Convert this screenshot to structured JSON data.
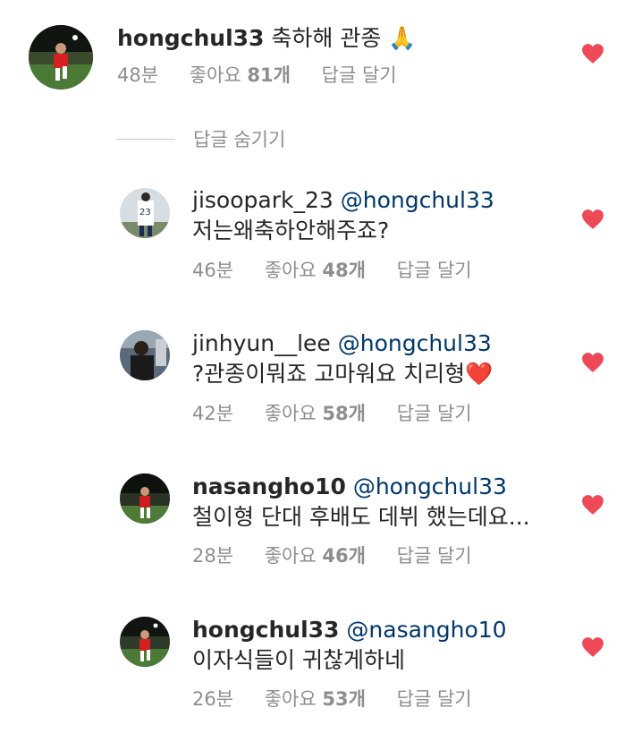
{
  "colors": {
    "heart": "#ed4956",
    "mention": "#00376b",
    "meta": "#8e8e8e",
    "text": "#262626"
  },
  "main_comment": {
    "username": "hongchul33",
    "text": "축하해 관종",
    "emoji": "🙏",
    "time": "48분",
    "likes_label": "좋아요",
    "likes_count": "81개",
    "reply_label": "답글 달기",
    "liked": true,
    "heart_icon": "heart-icon-filled"
  },
  "hide_replies": "답글 숨기기",
  "replies": [
    {
      "username": "jisoopark_23",
      "mention": "@hongchul33",
      "text": "저는왜축하안해주죠?",
      "time": "46분",
      "likes_label": "좋아요",
      "likes_count": "48개",
      "reply_label": "답글 달기",
      "liked": true
    },
    {
      "username": "jinhyun__lee",
      "mention": "@hongchul33",
      "text": "?관종이뭐죠 고마워요 치리형",
      "emoji": "❤️",
      "time": "42분",
      "likes_label": "좋아요",
      "likes_count": "58개",
      "reply_label": "답글 달기",
      "liked": true
    },
    {
      "username": "nasangho10",
      "mention": "@hongchul33",
      "text": "철이형 단대 후배도 데뷔 했는데요...",
      "time": "28분",
      "likes_label": "좋아요",
      "likes_count": "46개",
      "reply_label": "답글 달기",
      "liked": true
    },
    {
      "username": "hongchul33",
      "mention": "@nasangho10",
      "text": "이자식들이 귀찮게하네",
      "time": "26분",
      "likes_label": "좋아요",
      "likes_count": "53개",
      "reply_label": "답글 달기",
      "liked": true
    }
  ]
}
